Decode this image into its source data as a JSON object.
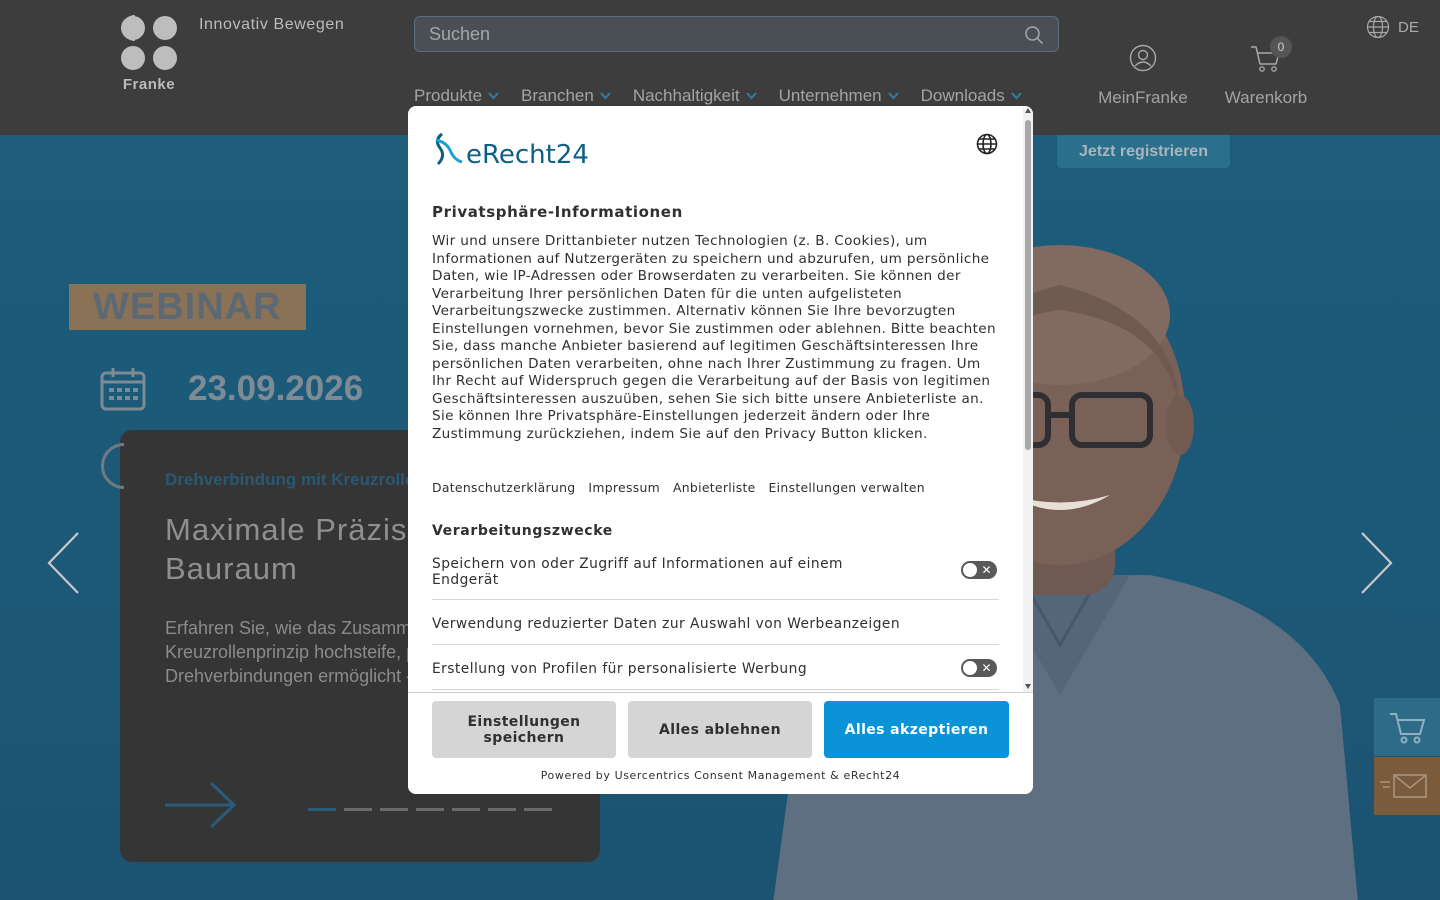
{
  "header": {
    "logo_text": "Franke",
    "tagline": "Innovativ Bewegen",
    "search": {
      "placeholder": "Suchen"
    },
    "language": "DE",
    "nav": [
      {
        "label": "Produkte"
      },
      {
        "label": "Branchen"
      },
      {
        "label": "Nachhaltigkeit"
      },
      {
        "label": "Unternehmen"
      },
      {
        "label": "Downloads"
      }
    ],
    "account_label": "MeinFranke",
    "cart_label": "Warenkorb",
    "cart_count": "0",
    "register_label": "Jetzt registrieren"
  },
  "hero": {
    "tag": "WEBINAR",
    "date": "23.09.2026",
    "card": {
      "subtitle": "Drehverbindung mit Kreuzrollen",
      "title": "Maximale Präzision bei minimalem Bauraum",
      "text": "Erfahren Sie, wie das Zusammenspiel von Drahtwälzlagertechnologie und Kreuzrollenprinzip hochsteife, präzise und extrem belastbare Drehverbindungen ermöglicht - ideal für anspruchsvolle Anwendungen."
    },
    "slides_total": 7,
    "active_slide": 1
  },
  "consent": {
    "brand": "eRecht24",
    "heading": "Privatsphäre-Informationen",
    "body": "Wir und unsere Drittanbieter nutzen Technologien (z. B. Cookies), um Informationen auf Nutzergeräten zu speichern und abzurufen, um persönliche Daten, wie IP-Adressen oder Browserdaten zu verarbeiten. Sie können der Verarbeitung Ihrer persönlichen Daten für die unten aufgelisteten Verarbeitungszwecke zustimmen. Alternativ können Sie Ihre bevorzugten Einstellungen vornehmen, bevor Sie zustimmen oder ablehnen. Bitte beachten Sie, dass manche Anbieter basierend auf legitimen Geschäftsinteressen Ihre persönlichen Daten verarbeiten, ohne nach Ihrer Zustimmung zu fragen. Um Ihr Recht auf Widerspruch gegen die Verarbeitung auf der Basis von legitimen Geschäftsinteressen auszuüben, sehen Sie sich bitte unsere Anbieterliste an. Sie können Ihre Privatsphäre-Einstellungen jederzeit ändern oder Ihre Zustimmung zurückziehen, indem Sie auf den Privacy Button klicken.",
    "links": {
      "privacy": "Datenschutzerklärung",
      "imprint": "Impressum",
      "vendors": "Anbieterliste",
      "manage": "Einstellungen verwalten"
    },
    "purposes_heading": "Verarbeitungszwecke",
    "purposes": [
      {
        "label": "Speichern von oder Zugriff auf Informationen auf einem Endgerät",
        "toggle": "off"
      },
      {
        "label": "Verwendung reduzierter Daten zur Auswahl von Werbeanzeigen",
        "toggle": "none"
      },
      {
        "label": "Erstellung von Profilen für personalisierte Werbung",
        "toggle": "off"
      }
    ],
    "buttons": {
      "save": "Einstellungen speichern",
      "deny": "Alles ablehnen",
      "accept": "Alles akzeptieren"
    },
    "powered_by": "Powered by Usercentrics Consent Management & eRecht24"
  }
}
